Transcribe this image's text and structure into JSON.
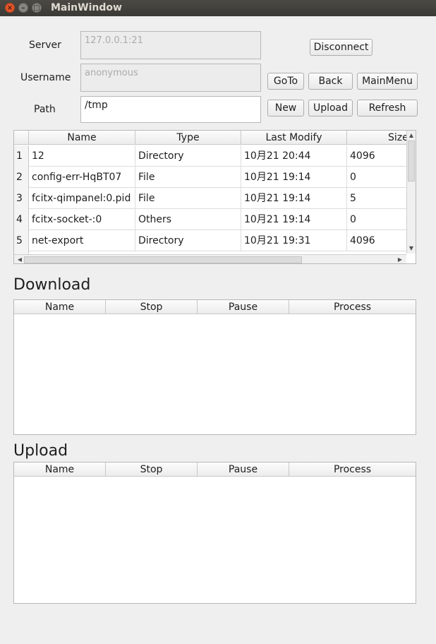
{
  "window": {
    "title": "MainWindow"
  },
  "connection": {
    "server_label": "Server",
    "server_value": "127.0.0.1:21",
    "username_label": "Username",
    "username_value": "anonymous",
    "path_label": "Path",
    "path_value": "/tmp"
  },
  "buttons": {
    "disconnect": "Disconnect",
    "goto": "GoTo",
    "back": "Back",
    "mainmenu": "MainMenu",
    "new": "New",
    "upload": "Upload",
    "refresh": "Refresh"
  },
  "files": {
    "columns": [
      "Name",
      "Type",
      "Last Modify",
      "Size"
    ],
    "rows": [
      {
        "num": "1",
        "name": "12",
        "type": "Directory",
        "modified": "10月21 20:44",
        "size": "4096"
      },
      {
        "num": "2",
        "name": "config-err-HqBT07",
        "type": "File",
        "modified": "10月21 19:14",
        "size": "0"
      },
      {
        "num": "3",
        "name": "fcitx-qimpanel:0.pid",
        "type": "File",
        "modified": "10月21 19:14",
        "size": "5"
      },
      {
        "num": "4",
        "name": "fcitx-socket-:0",
        "type": "Others",
        "modified": "10月21 19:14",
        "size": "0"
      },
      {
        "num": "5",
        "name": "net-export",
        "type": "Directory",
        "modified": "10月21 19:31",
        "size": "4096"
      }
    ]
  },
  "download": {
    "title": "Download",
    "columns": [
      "Name",
      "Stop",
      "Pause",
      "Process"
    ]
  },
  "upload": {
    "title": "Upload",
    "columns": [
      "Name",
      "Stop",
      "Pause",
      "Process"
    ]
  }
}
